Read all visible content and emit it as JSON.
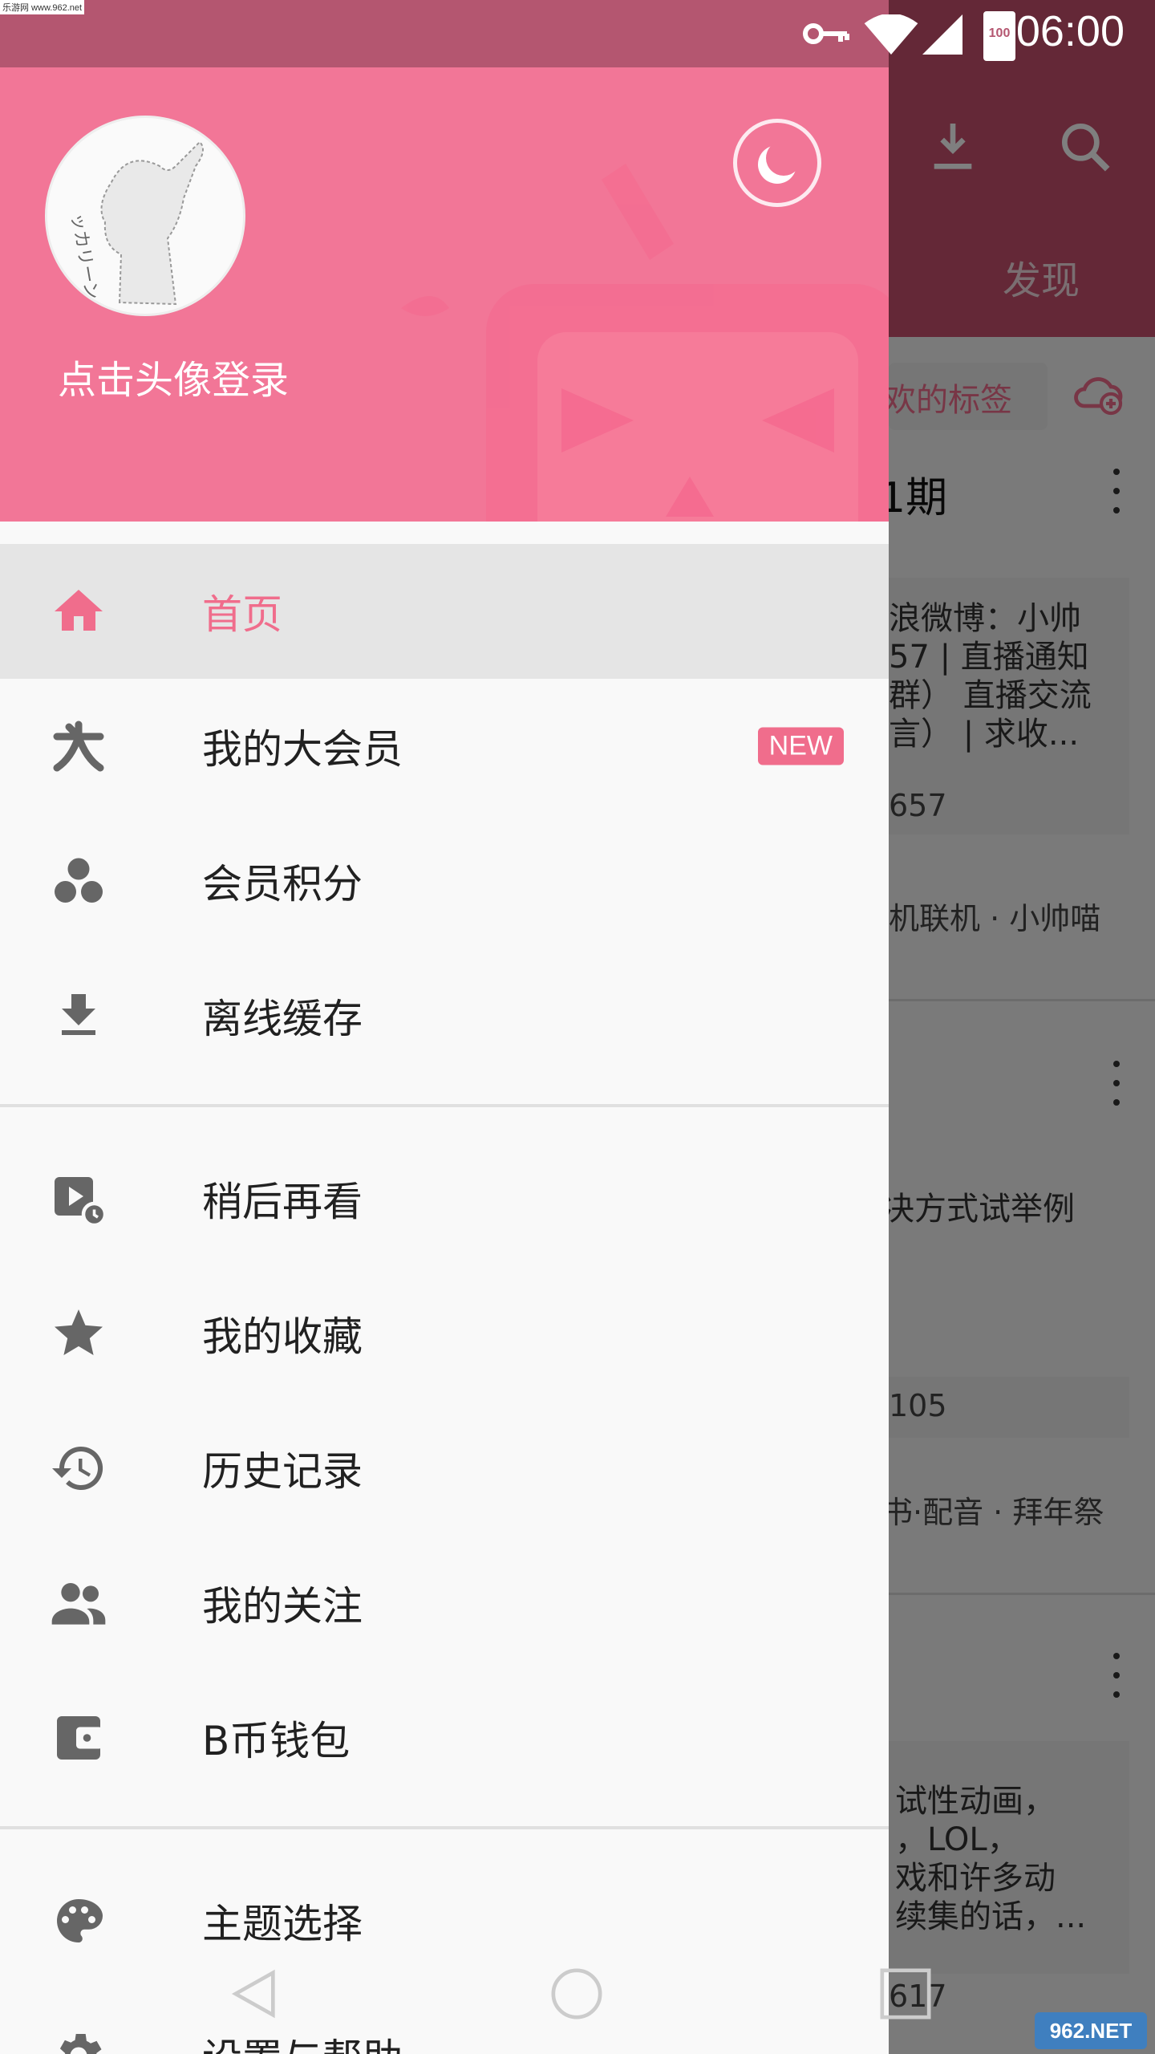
{
  "status_bar": {
    "time": "06:00",
    "battery": "100"
  },
  "watermark": {
    "top_left": "乐游网 www.962.net",
    "logo": "962.NET"
  },
  "background_app": {
    "tab_discover": "发现",
    "tag_chip": "欢的标签",
    "card1": {
      "title": "1期",
      "desc_lines": [
        "浪微博：小帅",
        "57 | 直播通知",
        "群） 直播交流",
        "言） | 求收..."
      ],
      "count": "657",
      "tags": "机联机 · 小帅喵"
    },
    "card2": {
      "desc": "决方式试举例",
      "count": "105",
      "tags": "书·配音 · 拜年祭"
    },
    "card3": {
      "desc_lines": [
        "试性动画，",
        "，LOL，",
        "戏和许多动",
        "续集的话，..."
      ],
      "count": "617"
    }
  },
  "drawer": {
    "login_text": "点击头像登录",
    "menu": [
      {
        "label": "首页",
        "icon": "home-icon"
      },
      {
        "label": "我的大会员",
        "icon": "vip-icon",
        "badge": "NEW"
      },
      {
        "label": "会员积分",
        "icon": "points-icon"
      },
      {
        "label": "离线缓存",
        "icon": "download-icon"
      },
      {
        "label": "稍后再看",
        "icon": "watch-later-icon"
      },
      {
        "label": "我的收藏",
        "icon": "star-icon"
      },
      {
        "label": "历史记录",
        "icon": "history-icon"
      },
      {
        "label": "我的关注",
        "icon": "people-icon"
      },
      {
        "label": "B币钱包",
        "icon": "wallet-icon"
      },
      {
        "label": "主题选择",
        "icon": "palette-icon"
      },
      {
        "label": "设置与帮助",
        "icon": "settings-icon"
      }
    ]
  },
  "colors": {
    "accent": "#f06d8c",
    "header": "#f27697",
    "status": "#b45670"
  }
}
